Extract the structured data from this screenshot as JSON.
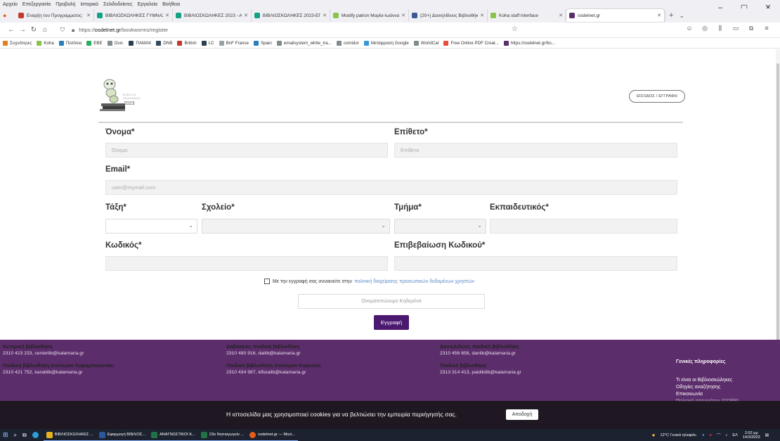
{
  "menubar": [
    "Αρχείο",
    "Επεξεργασία",
    "Προβολή",
    "Ιστορικό",
    "Σελιδοδείκτες",
    "Εργαλεία",
    "Βοήθεια"
  ],
  "window_controls": [
    "–",
    "▢",
    "✕"
  ],
  "tabs": [
    {
      "label": "Εναρξη του Προγραμματος: Ο",
      "color": "#c0392b"
    },
    {
      "label": "ΒΙΒΛΙΟΣΚΩΛΗΚΕΣ ΓΥΜΝΑΣΙΑ 2",
      "color": "#16a085"
    },
    {
      "label": "ΒΙΒΛΙΟΣΚΩΛΗΚΕΣ 2023 - ΑΤΟΜ",
      "color": "#16a085"
    },
    {
      "label": "ΒΙΒΛΙΟΣΚΩΛΗΚΕΣ 2023-ΕΓΓΡΑΦ",
      "color": "#16a085"
    },
    {
      "label": "Modify patron Μαρία-Ιωάννα",
      "color": "#8bc34a"
    },
    {
      "label": "(20+) Δανιηλίδειος Βιβλιοθήκη",
      "color": "#3b5998"
    },
    {
      "label": "Koha staff interface",
      "color": "#8bc34a"
    }
  ],
  "active_tab": {
    "label": "osdelnet.gr",
    "color": "#5c2d6b"
  },
  "url": {
    "prefix": "https://",
    "host": "osdelnet.gr",
    "path": "/bookworms/register"
  },
  "bookmarks": [
    {
      "label": "Συχνότερες",
      "color": "#e67e22"
    },
    {
      "label": "Koha",
      "color": "#8bc34a"
    },
    {
      "label": "Πολίτεια",
      "color": "#2980b9"
    },
    {
      "label": "ΕΒΕ",
      "color": "#27ae60"
    },
    {
      "label": "Ουσ.",
      "color": "#7f8c8d"
    },
    {
      "label": "ΠΑΜΑΚ",
      "color": "#2c3e50"
    },
    {
      "label": "DNB",
      "color": "#34495e"
    },
    {
      "label": "British",
      "color": "#c0392b"
    },
    {
      "label": "LC",
      "color": "#2c3e50"
    },
    {
      "label": "BnF France",
      "color": "#95a5a6"
    },
    {
      "label": "Spain",
      "color": "#2980b9"
    },
    {
      "label": "emailsystem_white_tra...",
      "color": "#7f8c8d"
    },
    {
      "label": "comidor",
      "color": "#7f8c8d"
    },
    {
      "label": "Μετάφραση Google",
      "color": "#3498db"
    },
    {
      "label": "WorldCat",
      "color": "#7f8c8d"
    },
    {
      "label": "Free Online PDF Creat...",
      "color": "#e74c3c"
    },
    {
      "label": "https://osdelnet.gr/bo...",
      "color": "#5c2d6b"
    }
  ],
  "logo": {
    "line1": "ΒΙΒΛΙΟ",
    "line2": "ΣΚΩΛΗΚΕΣ",
    "year": "2023"
  },
  "login_button": "ΕΙΣΟΔΟΣ / ΕΓΓΡΑΦΗ",
  "form": {
    "first_name": {
      "label": "Όνομα*",
      "placeholder": "Όνομα"
    },
    "last_name": {
      "label": "Επίθετο*",
      "placeholder": "Επίθετο"
    },
    "email": {
      "label": "Email*",
      "placeholder": "user@mymail.com"
    },
    "grade": {
      "label": "Τάξη*"
    },
    "school": {
      "label": "Σχολείο*"
    },
    "section": {
      "label": "Τμήμα*"
    },
    "teacher": {
      "label": "Εκπαιδευτικός*"
    },
    "password": {
      "label": "Κωδικός*"
    },
    "password_confirm": {
      "label": "Επιβεβαίωση Κωδικού*"
    },
    "consent_text": "Με την εγγραφή σας συναινείτε στην",
    "consent_link": "πολιτική διαχείρισης προσωπικών δεδομένων χρηστών",
    "guardian_placeholder": "Ονοματεπώνυμο Κηδεμόνα",
    "submit": "Εγγραφή"
  },
  "footer": {
    "libraries": [
      {
        "name": "Κεντρική βιβλιοθήκη",
        "details": "2310 423 233, centerlib@kalamaria.gr"
      },
      {
        "name": "Παιδική βιβλιοθήκη συν/σμού Καραμπουρνάκι",
        "details": "2310 421 752, karablib@kalamaria.gr"
      },
      {
        "name": "Δαβάκειος παιδική βιβλιοθήκη",
        "details": "2310 480 916, dailib@kalamaria.gr"
      },
      {
        "name": "Παιδική βιβλιοθήκη συν/σμού Κηφισιάς",
        "details": "2310 434 987, kifisialib@kalamaria.gr"
      },
      {
        "name": "Δανιηλίδειος παιδική βιβλιοθήκη",
        "details": "2310 456 658, danlib@kalamaria.gr"
      },
      {
        "name": "Παιδική βιβλιοθήκη",
        "details": "2313 314 413, paidikilib@kalamaria.gr"
      }
    ],
    "info_title": "Γενικές πληροφορίες",
    "info_links": [
      "Τι είναι οι Βιβλιοσκώληκες",
      "Οδηγίες αναζήτησης",
      "Επικοινωνία",
      "Πολιτική απορρήτου (GDPR)"
    ]
  },
  "cookie": {
    "text": "Η ιστοσελίδα μας χρησιμοποιεί cookies για να βελτιώσει την εμπειρία περιήγησής σας.",
    "accept": "Αποδοχή"
  },
  "taskbar": {
    "apps": [
      {
        "label": "ΒΙΒΛΙΟΣΚΩΛΗΚΕΣ ...",
        "color": "#e6b422"
      },
      {
        "label": "Εφαρμογή ΒΙΒΛΙΟΣ...",
        "color": "#2b579a"
      },
      {
        "label": "ΑΝΑΓΝΩΣΤΙΚΟΙ Κ...",
        "color": "#217346"
      },
      {
        "label": "23ο Νηπιαγωγείο ...",
        "color": "#217346"
      },
      {
        "label": "osdelnet.gr — Mozi...",
        "color": "#e35d1c"
      }
    ],
    "weather": "12°C Γενικά ηλιοφάν.",
    "lang": "ΕΛ",
    "time": "2:02 μμ",
    "date": "14/3/2023"
  }
}
